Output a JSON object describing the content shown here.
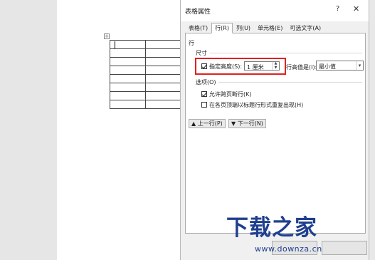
{
  "dialog": {
    "title": "表格属性",
    "help": "?",
    "close": "✕"
  },
  "tabs": [
    {
      "label": "表格(T)"
    },
    {
      "label": "行(R)"
    },
    {
      "label": "列(U)"
    },
    {
      "label": "单元格(E)"
    },
    {
      "label": "可选文字(A)"
    }
  ],
  "row_panel": {
    "header": "行",
    "size_group": "尺寸",
    "specify_height_label": "指定高度(S):",
    "specify_height_checked": true,
    "height_value": "1 厘米",
    "height_is_label": "行高值是(I):",
    "height_is_value": "最小值",
    "options_group": "选项(O)",
    "allow_break_label": "允许跨页断行(K)",
    "allow_break_checked": true,
    "repeat_header_label": "在各页顶端以标题行形式重复出现(H)",
    "repeat_header_checked": false,
    "prev_row": "▲ 上一行(P)",
    "next_row": "▼ 下一行(N)"
  },
  "watermark": {
    "logo_text": "下载之家",
    "url": "www.downza.cn"
  },
  "colors": {
    "highlight": "#e02020",
    "watermark": "#1f3f8f"
  }
}
